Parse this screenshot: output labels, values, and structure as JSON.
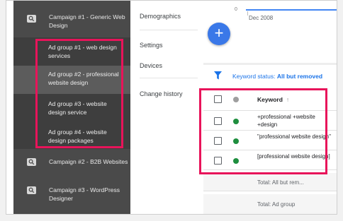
{
  "sidebar": {
    "campaigns": [
      {
        "label": "Campaign #1 - Generic Web Design"
      },
      {
        "label": "Campaign #2 - B2B Websites"
      },
      {
        "label": "Campaign #3 - WordPress Designer"
      }
    ],
    "ad_groups": [
      {
        "label": "Ad group #1 - web design services",
        "selected": false
      },
      {
        "label": "Ad group #2 - professional website design",
        "selected": true
      },
      {
        "label": "Ad group #3 - website design service",
        "selected": false
      },
      {
        "label": "Ad group #4 - website design packages",
        "selected": false
      }
    ]
  },
  "nav": {
    "items": [
      "Demographics",
      "Settings",
      "Devices",
      "Change history"
    ]
  },
  "chart": {
    "zero_label": "0",
    "date_label": "Dec 2008"
  },
  "fab": {
    "label": "+"
  },
  "filter": {
    "prefix": "Keyword status: ",
    "value": "All but removed"
  },
  "table": {
    "header": {
      "keyword": "Keyword",
      "sort_icon": "↑"
    },
    "rows": [
      {
        "keyword": "+professional +website +design",
        "status": "enabled"
      },
      {
        "keyword": "\"professional website design\"",
        "status": "enabled"
      },
      {
        "keyword": "[professional website design]",
        "status": "enabled"
      }
    ],
    "totals": [
      "Total: All but rem...",
      "Total: Ad group"
    ]
  },
  "colors": {
    "highlight": "#e8145a",
    "accent": "#1a73e8",
    "enabled_dot": "#1e8e3e",
    "header_dot": "#9e9e9e",
    "sidebar": "#4a4a4a"
  }
}
